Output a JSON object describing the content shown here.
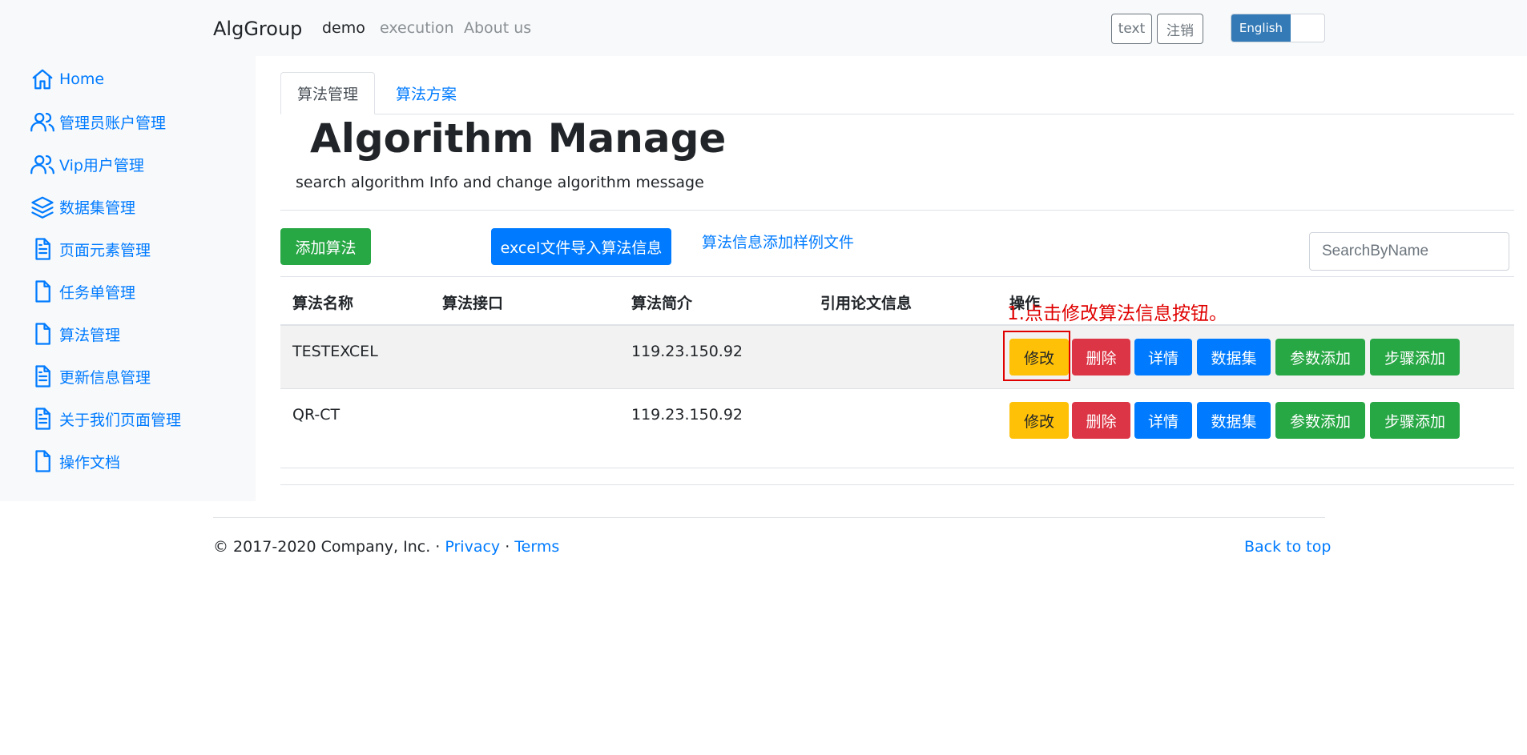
{
  "navbar": {
    "brand": "AlgGroup",
    "links": [
      "demo",
      "execution",
      "About us"
    ],
    "text_button": "text",
    "logout_button": "注销",
    "language": "English"
  },
  "sidebar": {
    "items": [
      {
        "label": "Home",
        "icon": "home-icon"
      },
      {
        "label": "管理员账户管理",
        "icon": "users-icon"
      },
      {
        "label": "Vip用户管理",
        "icon": "users-icon"
      },
      {
        "label": "数据集管理",
        "icon": "layers-icon"
      },
      {
        "label": "页面元素管理",
        "icon": "file-text-icon"
      },
      {
        "label": "任务单管理",
        "icon": "file-icon"
      },
      {
        "label": "算法管理",
        "icon": "file-icon"
      },
      {
        "label": "更新信息管理",
        "icon": "file-text-icon"
      },
      {
        "label": "关于我们页面管理",
        "icon": "file-text-icon"
      },
      {
        "label": "操作文档",
        "icon": "file-icon"
      }
    ]
  },
  "tabs": [
    "算法管理",
    "算法方案"
  ],
  "header": {
    "title": "Algorithm Manage",
    "subtitle": "search algorithm Info and change algorithm message"
  },
  "toolbar": {
    "add_button": "添加算法",
    "import_button": "excel文件导入算法信息",
    "sample_link": "算法信息添加样例文件",
    "search_placeholder": "SearchByName"
  },
  "table": {
    "columns": [
      "算法名称",
      "算法接口",
      "算法简介",
      "引用论文信息",
      "操作"
    ],
    "rows": [
      {
        "name": "TESTEXCEL",
        "interface": "",
        "intro": "119.23.150.92",
        "paper": ""
      },
      {
        "name": "QR-CT",
        "interface": "",
        "intro": "119.23.150.92",
        "paper": ""
      }
    ],
    "actions": [
      "修改",
      "删除",
      "详情",
      "数据集",
      "参数添加",
      "步骤添加"
    ]
  },
  "annotation": "1.点击修改算法信息按钮。",
  "footer": {
    "copyright": "© 2017-2020 Company, Inc. · ",
    "privacy": "Privacy",
    "separator": " · ",
    "terms": "Terms",
    "back_to_top": "Back to top"
  },
  "colors": {
    "primary": "#007bff",
    "success": "#28a745",
    "danger": "#dc3545",
    "warning": "#ffc107",
    "annotation": "#e00000"
  }
}
